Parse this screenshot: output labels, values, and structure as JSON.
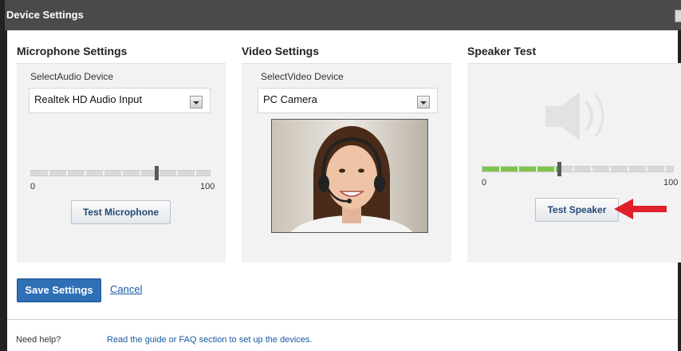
{
  "window": {
    "title": "Device Settings"
  },
  "microphone": {
    "section_title": "Microphone Settings",
    "device_label": "SelectAudio Device",
    "device_value": "Realtek HD Audio Input",
    "slider_min": "0",
    "slider_max": "100",
    "level_value": 70,
    "test_button": "Test Microphone"
  },
  "video": {
    "section_title": "Video Settings",
    "device_label": "SelectVideo Device",
    "device_value": "PC Camera"
  },
  "speaker": {
    "section_title": "Speaker Test",
    "slider_min": "0",
    "slider_max": "100",
    "level_value": 40,
    "test_button": "Test Speaker"
  },
  "actions": {
    "save_label": "Save Settings",
    "cancel_label": "Cancel"
  },
  "help": {
    "question": "Need help?",
    "link_text": "Read the guide or FAQ section to set up the devices."
  },
  "colors": {
    "title_bar": "#4a4a4a",
    "save_button": "#2e6fb5",
    "link": "#1a5aa0",
    "speaker_fill": "#7cc44c",
    "annotation_arrow": "#e0202a"
  },
  "icons": [
    "speaker-icon",
    "close-icon",
    "dropdown-arrow-icon",
    "annotation-arrow-icon"
  ]
}
